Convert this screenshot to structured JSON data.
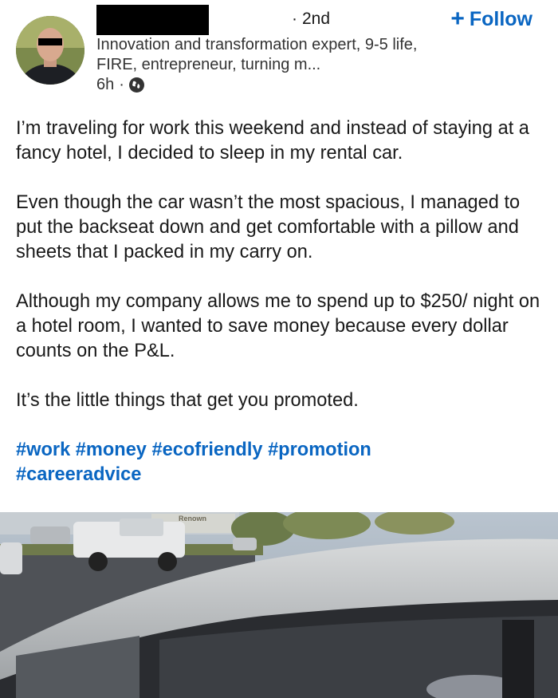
{
  "author": {
    "connection_degree": "2nd",
    "headline": "Innovation and transformation expert, 9-5 life, FIRE, entrepreneur, turning m...",
    "time_ago": "6h",
    "visibility_icon": "globe-icon"
  },
  "follow_button": {
    "icon": "plus-icon",
    "label": "Follow"
  },
  "post": {
    "paragraphs": [
      "I’m traveling for work this weekend and instead of staying at a fancy hotel, I decided to sleep in my rental car.",
      "Even though the car wasn’t the most spacious, I managed to put the backseat down and get comfortable with a pillow and sheets that I packed in my carry on.",
      "Although my company allows me to spend up to $250/ night on a hotel room, I wanted to save money because every dollar counts on the P&L.",
      "It’s the little things that get you promoted."
    ],
    "hashtags": [
      "#work",
      "#money",
      "#ecofriendly",
      "#promotion",
      "#careeradvice"
    ]
  },
  "photo": {
    "sign_text": "Renown"
  },
  "colors": {
    "link_blue": "#0a66c2",
    "text": "#191919",
    "redaction": "#000000"
  }
}
